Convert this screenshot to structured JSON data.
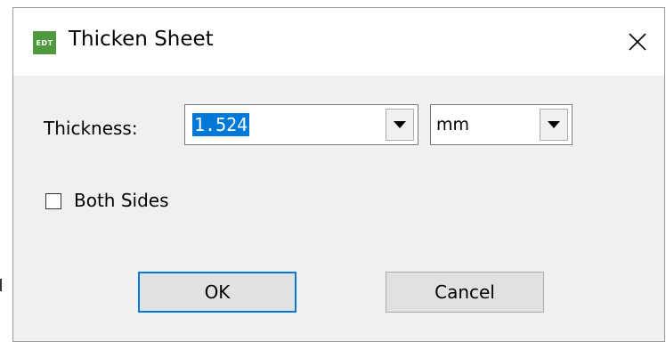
{
  "window": {
    "app_icon_text": "EDT",
    "title": "Thicken Sheet",
    "close_icon": "close-icon"
  },
  "form": {
    "thickness_label": "Thickness:",
    "thickness_value": "1.524",
    "unit_value": "mm",
    "both_sides_label": "Both Sides",
    "both_sides_checked": false
  },
  "buttons": {
    "ok": "OK",
    "cancel": "Cancel"
  },
  "colors": {
    "app_icon": "#4e9a3c",
    "selection": "#0078d7"
  }
}
